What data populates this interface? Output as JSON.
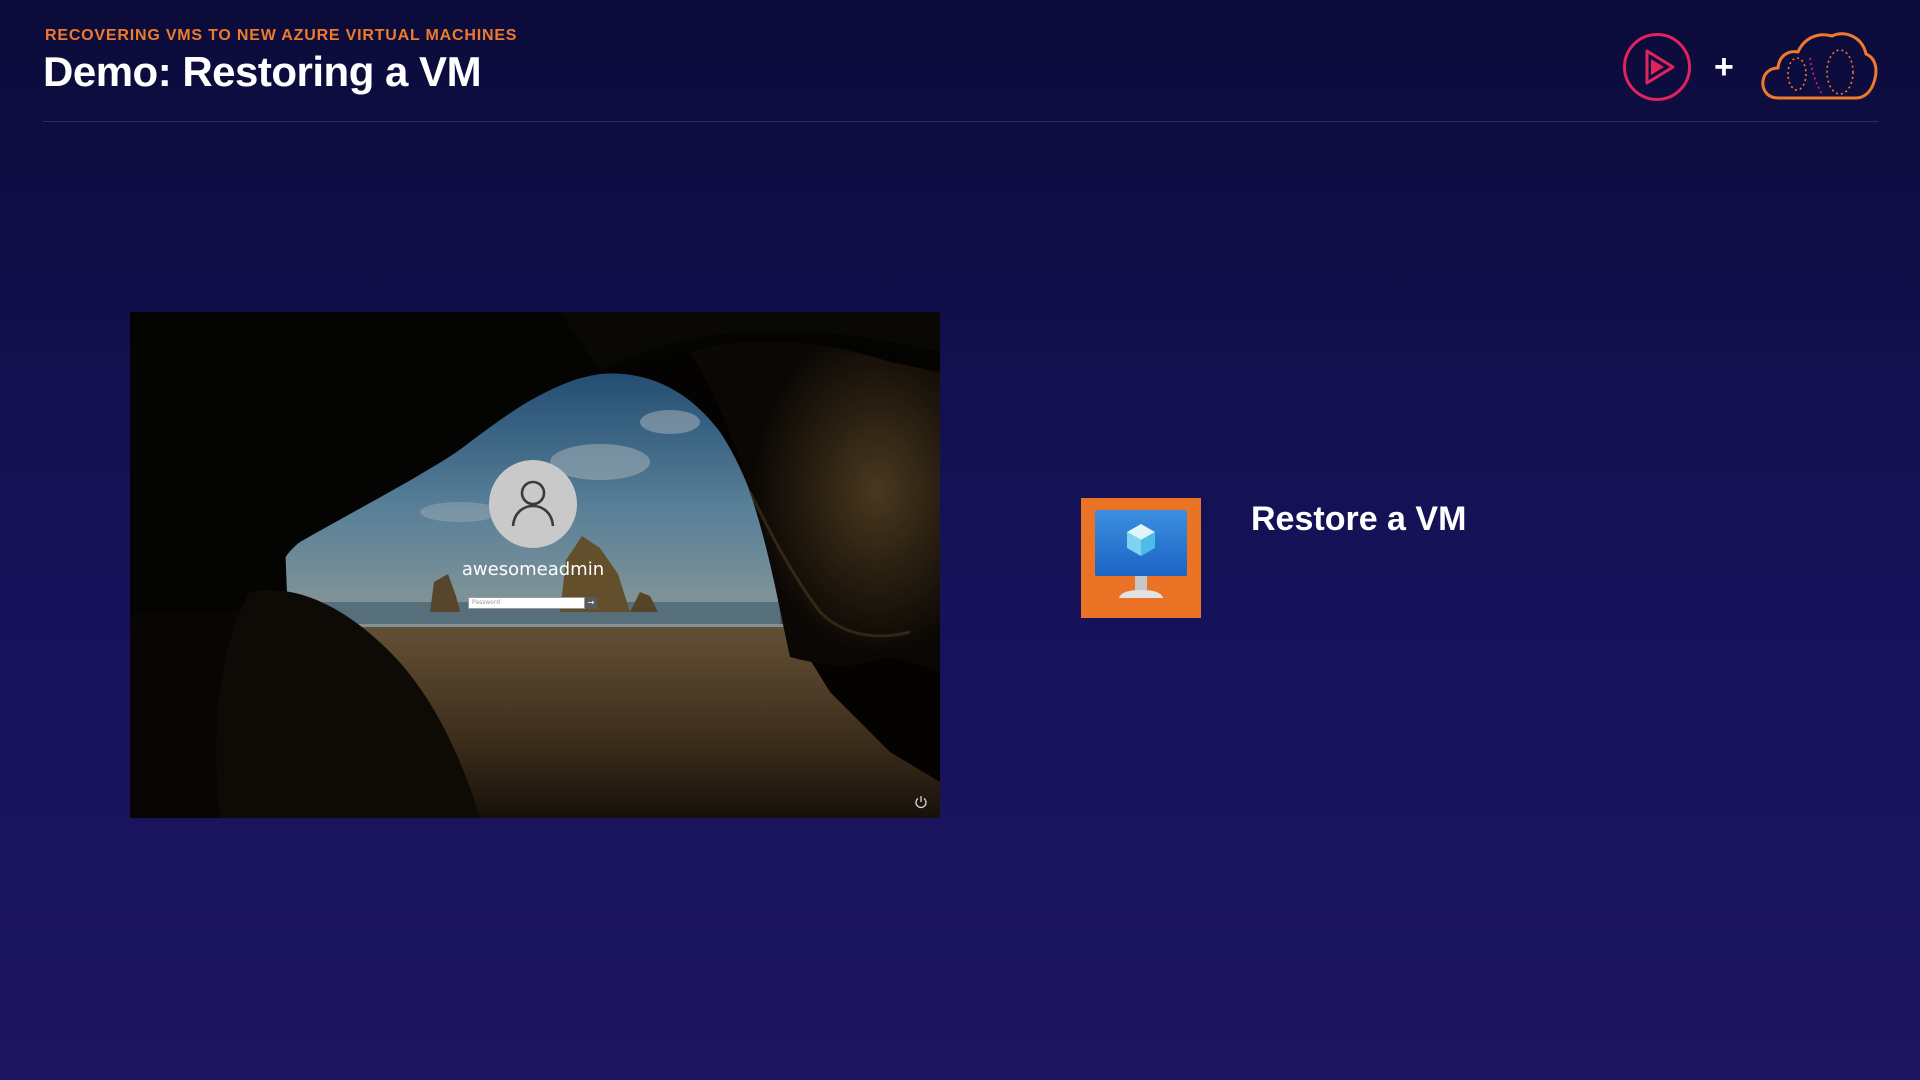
{
  "header": {
    "eyebrow": "RECOVERING VMS TO NEW AZURE VIRTUAL MACHINES",
    "title": "Demo: Restoring a VM",
    "plus": "+"
  },
  "brand": {
    "logos": [
      "play-logo-icon",
      "cloud-logo-icon"
    ],
    "play_color": "#e0225f",
    "cloud_color": "#f07a2c",
    "eyebrow_color": "#f07a2c"
  },
  "vm_screen": {
    "username": "awesomeadmin",
    "password_placeholder": "Password",
    "submit_glyph": "→",
    "icons": [
      "user-avatar-icon",
      "power-icon"
    ]
  },
  "step": {
    "heading": "Restore a VM",
    "icon": "virtual-machine-icon",
    "icon_bg": "#ea7325"
  }
}
